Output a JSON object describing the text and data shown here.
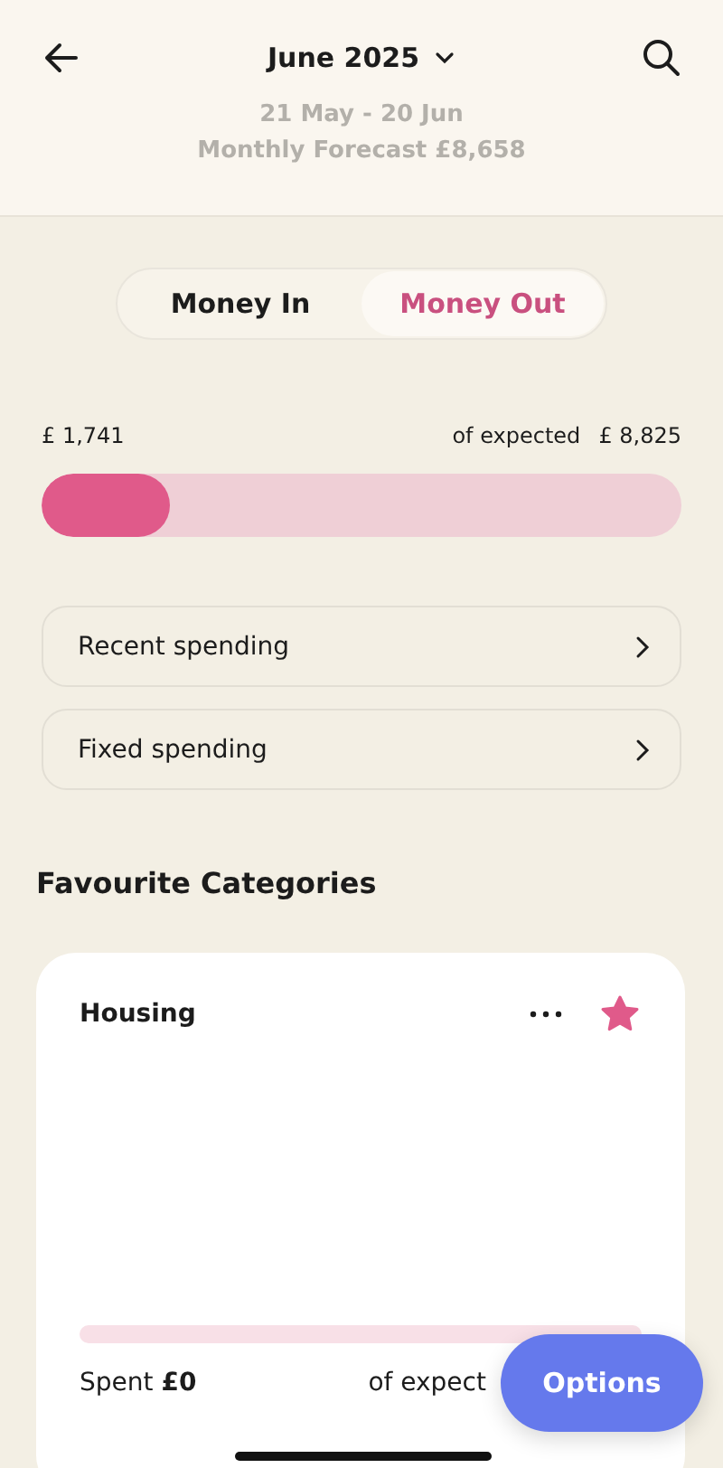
{
  "header": {
    "title": "June 2025",
    "period": "21 May - 20 Jun",
    "forecast": "Monthly Forecast £8,658"
  },
  "toggle": [
    {
      "label": "Money In",
      "selected": false
    },
    {
      "label": "Money Out",
      "selected": true
    }
  ],
  "summary": {
    "spent": "£ 1,741",
    "expected_label": "of expected",
    "expected": "£ 8,825",
    "level": 0.2
  },
  "links": [
    {
      "label": "Recent spending"
    },
    {
      "label": "Fixed spending"
    }
  ],
  "favourites": {
    "heading": "Favourite Categories",
    "cards": [
      {
        "name": "Housing",
        "favourite": true,
        "spent": "Spent **£0**",
        "expected": "of expect"
      }
    ]
  },
  "fab": {
    "label": "Options"
  }
}
